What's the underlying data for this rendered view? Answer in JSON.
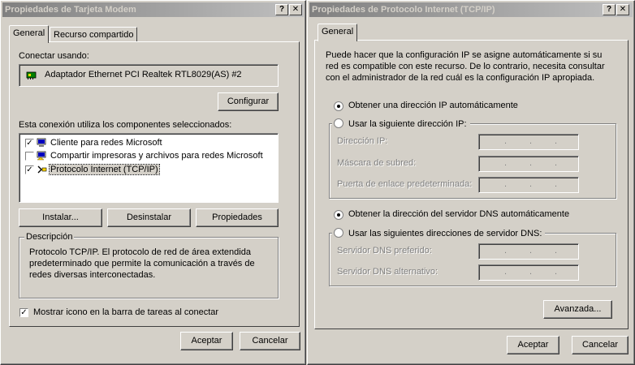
{
  "modem_dialog": {
    "title": "Propiedades de Tarjeta Modem",
    "help_btn": "?",
    "close_btn": "✕",
    "tabs": [
      "General",
      "Recurso compartido"
    ],
    "connect_using_label": "Conectar usando:",
    "adapter_name": "Adaptador Ethernet PCI Realtek RTL8029(AS) #2",
    "configure_btn": "Configurar",
    "components_label": "Esta conexión utiliza los componentes seleccionados:",
    "components": [
      {
        "label": "Cliente para redes Microsoft",
        "checked": true
      },
      {
        "label": "Compartir impresoras y archivos para redes Microsoft",
        "checked": false
      },
      {
        "label": "Protocolo Internet (TCP/IP)",
        "checked": true
      }
    ],
    "install_btn": "Instalar...",
    "uninstall_btn": "Desinstalar",
    "properties_btn": "Propiedades",
    "description_legend": "Descripción",
    "description_text": [
      "Protocolo TCP/IP. El protocolo de red de área extendida",
      "predeterminado que permite la comunicación a través de",
      "redes diversas interconectadas."
    ],
    "show_icon_label": "Mostrar icono en la barra de tareas al conectar",
    "show_icon_checked": true,
    "ok_btn": "Aceptar",
    "cancel_btn": "Cancelar"
  },
  "tcpip_dialog": {
    "title": "Propiedades de Protocolo Internet (TCP/IP)",
    "help_btn": "?",
    "close_btn": "✕",
    "tabs": [
      "General"
    ],
    "intro_text": [
      "Puede hacer que la configuración IP se asigne automáticamente si su",
      "red es compatible con este recurso. De lo contrario, necesita consultar",
      "con el administrador de la red cuál es la configuración IP apropiada."
    ],
    "ip_auto_label": "Obtener una dirección IP automáticamente",
    "ip_manual_label": "Usar la siguiente dirección IP:",
    "ip_address_label": "Dirección IP:",
    "subnet_label": "Máscara de subred:",
    "gateway_label": "Puerta de enlace predeterminada:",
    "dns_auto_label": "Obtener la dirección del servidor DNS automáticamente",
    "dns_manual_label": "Usar las siguientes direcciones de servidor DNS:",
    "dns_preferred_label": "Servidor DNS preferido:",
    "dns_alternate_label": "Servidor DNS alternativo:",
    "ip_dot": ".",
    "advanced_btn": "Avanzada...",
    "ok_btn": "Aceptar",
    "cancel_btn": "Cancelar"
  }
}
